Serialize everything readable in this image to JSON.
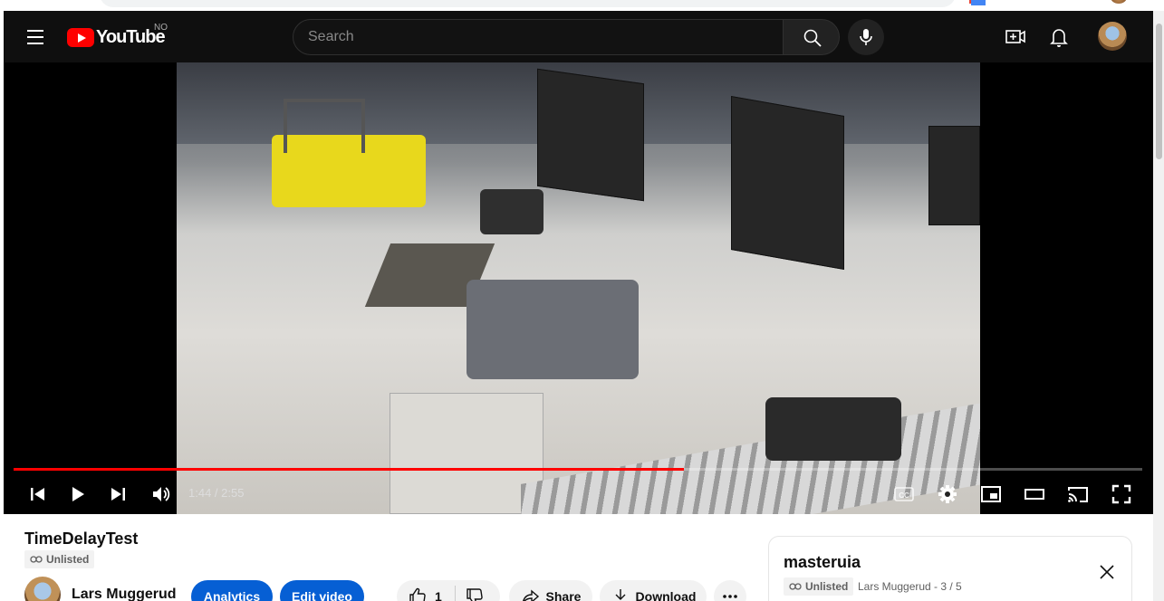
{
  "masthead": {
    "logo_text": "YouTube",
    "region": "NO",
    "search_placeholder": "Search"
  },
  "player": {
    "current_time": "1:44",
    "duration": "2:55",
    "time_display": "1:44 / 2:55",
    "progress_fraction": 0.594
  },
  "video": {
    "title": "TimeDelayTest",
    "visibility": "Unlisted"
  },
  "channel": {
    "name": "Lars Muggerud"
  },
  "actions": {
    "analytics_label": "Analytics",
    "edit_label": "Edit video",
    "like_count": "1",
    "share_label": "Share",
    "download_label": "Download"
  },
  "playlist": {
    "title": "masteruia",
    "visibility": "Unlisted",
    "meta": "Lars Muggerud - 3 / 5"
  },
  "colors": {
    "accent": "#ff0000",
    "primary_button": "#065fd4",
    "masthead_bg": "#0f0f0f"
  },
  "icons": [
    "menu-icon",
    "youtube-logo",
    "search-icon",
    "mic-icon",
    "create-icon",
    "bell-icon",
    "prev-icon",
    "play-icon",
    "next-icon",
    "volume-icon",
    "cc-icon",
    "gear-icon",
    "miniplayer-icon",
    "theater-icon",
    "cast-icon",
    "fullscreen-icon",
    "link-icon",
    "like-icon",
    "dislike-icon",
    "share-icon",
    "download-icon",
    "more-icon",
    "close-icon"
  ]
}
